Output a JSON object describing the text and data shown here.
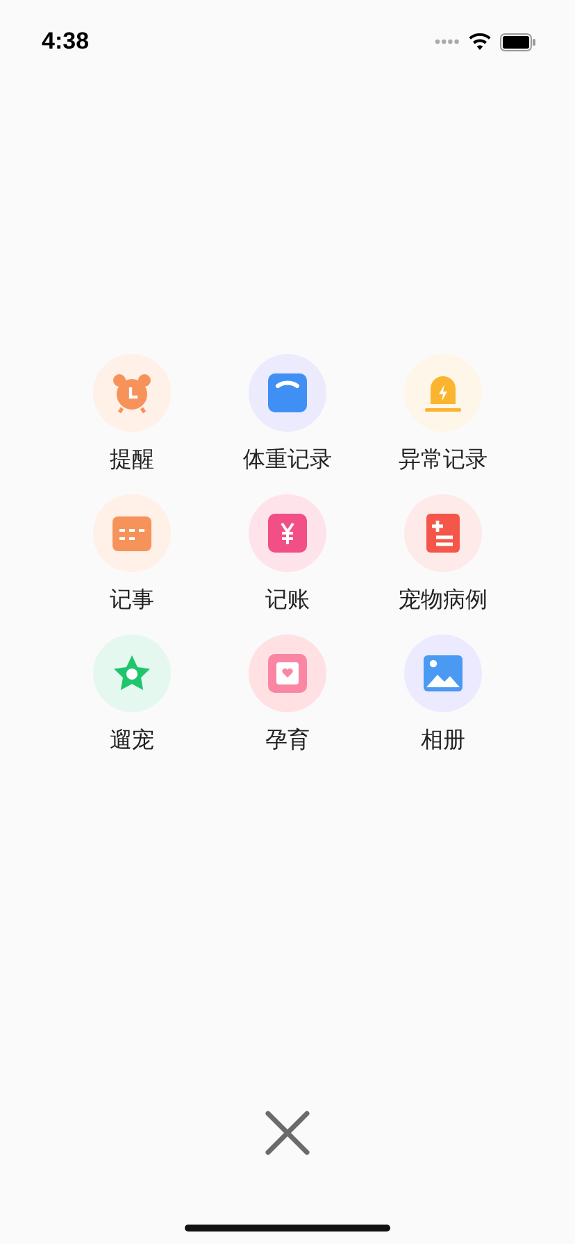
{
  "status_bar": {
    "time": "4:38"
  },
  "items": [
    {
      "label": "提醒",
      "kind": "alarm"
    },
    {
      "label": "体重记录",
      "kind": "scale"
    },
    {
      "label": "异常记录",
      "kind": "alert"
    },
    {
      "label": "记事",
      "kind": "calendar"
    },
    {
      "label": "记账",
      "kind": "money"
    },
    {
      "label": "宠物病例",
      "kind": "medical"
    },
    {
      "label": "遛宠",
      "kind": "star"
    },
    {
      "label": "孕育",
      "kind": "heart"
    },
    {
      "label": "相册",
      "kind": "photo"
    }
  ]
}
